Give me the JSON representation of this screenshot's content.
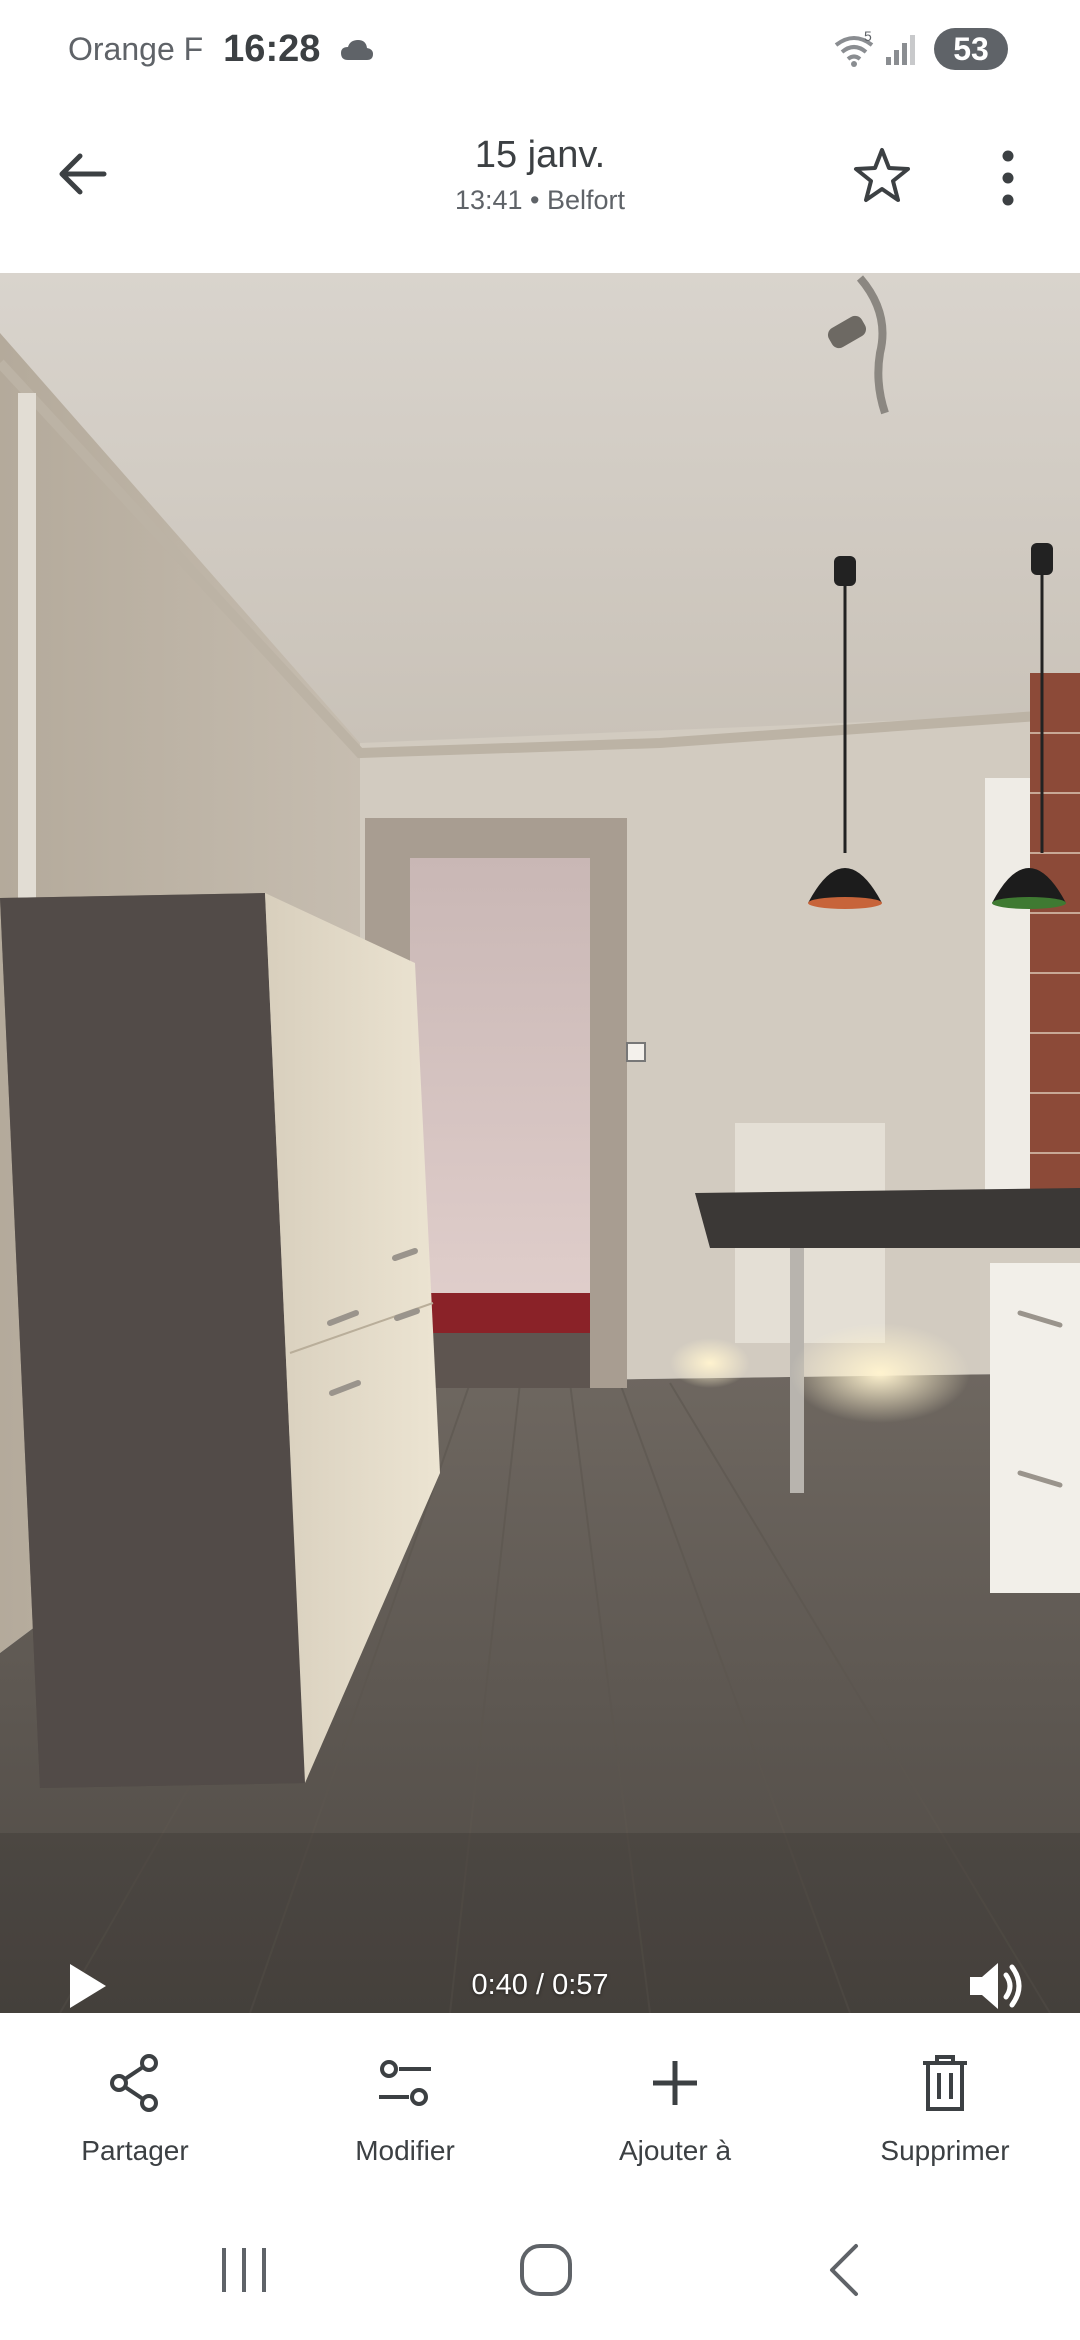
{
  "status_bar": {
    "carrier": "Orange F",
    "time": "16:28",
    "battery": "53",
    "icons": [
      "cloud-icon",
      "wifi-5g-icon",
      "signal-icon"
    ]
  },
  "header": {
    "title": "15 janv.",
    "subtitle": "13:41 • Belfort",
    "icons": [
      "back-arrow-icon",
      "star-outline-icon",
      "more-vert-icon"
    ]
  },
  "player": {
    "time": "0:40 / 0:57",
    "progress": 0.7,
    "icons": [
      "play-icon",
      "volume-icon"
    ]
  },
  "actions": [
    {
      "label": "Partager",
      "icon": "share-icon"
    },
    {
      "label": "Modifier",
      "icon": "edit-sliders-icon"
    },
    {
      "label": "Ajouter à",
      "icon": "add-icon"
    },
    {
      "label": "Supprimer",
      "icon": "trash-icon"
    }
  ],
  "nav": {
    "icons": [
      "recents-icon",
      "home-icon",
      "back-icon"
    ]
  },
  "colors": {
    "text_primary": "#3c4043",
    "text_secondary": "#5f6368",
    "background": "#ffffff"
  }
}
